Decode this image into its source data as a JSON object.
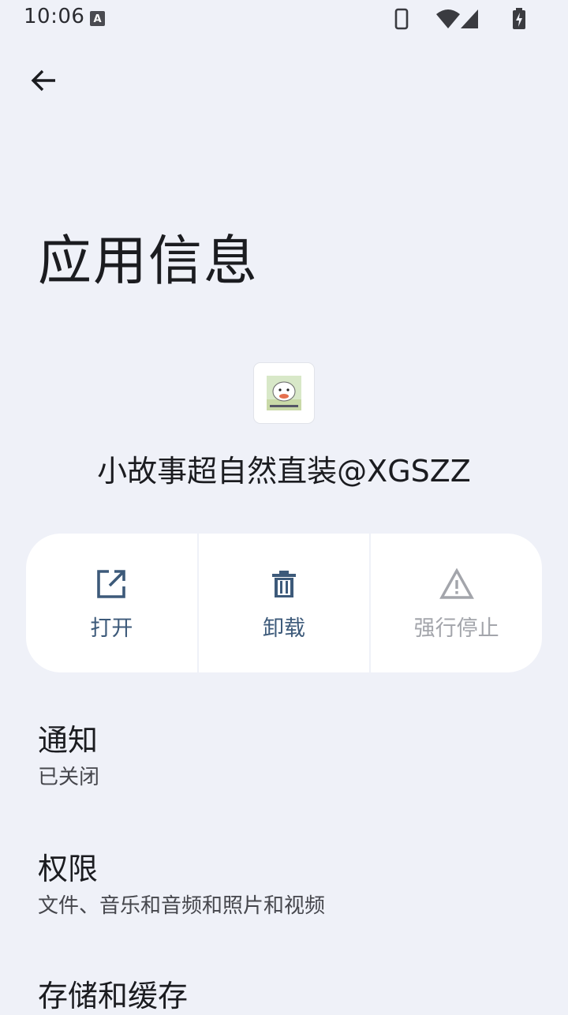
{
  "status_bar": {
    "time": "10:06",
    "icons": [
      "keyboard-a-icon",
      "phone-icon",
      "wifi-icon",
      "cell-signal-icon",
      "battery-charging-icon"
    ]
  },
  "header": {
    "back_icon": "arrow-back-icon",
    "title": "应用信息"
  },
  "app": {
    "name": "小故事超自然直装@XGSZZ"
  },
  "actions": [
    {
      "label": "打开",
      "icon": "open-external-icon",
      "enabled": true
    },
    {
      "label": "卸载",
      "icon": "trash-icon",
      "enabled": true
    },
    {
      "label": "强行停止",
      "icon": "warning-icon",
      "enabled": false
    }
  ],
  "settings": [
    {
      "title": "通知",
      "subtitle": "已关闭"
    },
    {
      "title": "权限",
      "subtitle": "文件、音乐和音频和照片和视频"
    },
    {
      "title": "存储和缓存",
      "subtitle": ""
    }
  ],
  "colors": {
    "background": "#eff1f8",
    "card": "#ffffff",
    "accent": "#3d5a7a",
    "disabled": "#a3a5ab"
  }
}
